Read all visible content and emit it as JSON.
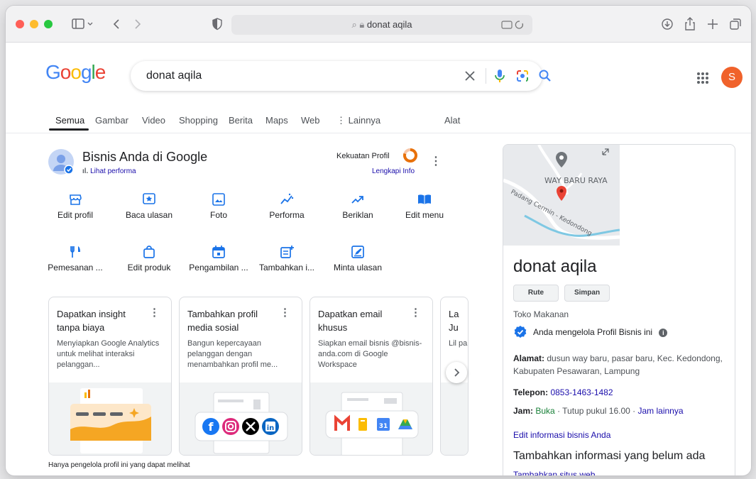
{
  "browser": {
    "address": "donat aqila",
    "reader_label": "Reader"
  },
  "google": {
    "logo": [
      "G",
      "o",
      "o",
      "g",
      "l",
      "e"
    ],
    "query": "donat aqila",
    "avatar_initial": "S",
    "tabs": [
      {
        "label": "Semua"
      },
      {
        "label": "Gambar"
      },
      {
        "label": "Video"
      },
      {
        "label": "Shopping"
      },
      {
        "label": "Berita"
      },
      {
        "label": "Maps"
      },
      {
        "label": "Web"
      },
      {
        "label": "⋮ Lainnya"
      },
      {
        "label": "Alat"
      }
    ]
  },
  "profile": {
    "title": "Bisnis Anda di Google",
    "performance_link": "Lihat performa",
    "strength_label": "Kekuatan Profil",
    "complete_link": "Lengkapi Info",
    "actions": [
      {
        "label": "Edit profil",
        "icon": "storefront-icon"
      },
      {
        "label": "Baca ulasan",
        "icon": "review-star-icon"
      },
      {
        "label": "Foto",
        "icon": "photo-icon"
      },
      {
        "label": "Performa",
        "icon": "performance-icon"
      },
      {
        "label": "Beriklan",
        "icon": "trend-icon"
      },
      {
        "label": "Edit menu",
        "icon": "menu-book-icon"
      },
      {
        "label": "Pemesanan ...",
        "icon": "restaurant-icon"
      },
      {
        "label": "Edit produk",
        "icon": "shopping-bag-icon"
      },
      {
        "label": "Pengambilan ...",
        "icon": "calendar-icon"
      },
      {
        "label": "Tambahkan i...",
        "icon": "add-post-icon"
      },
      {
        "label": "Minta ulasan",
        "icon": "request-review-icon"
      }
    ],
    "cards": [
      {
        "title": "Dapatkan insight tanpa biaya",
        "desc": "Menyiapkan Google Analytics untuk melihat interaksi pelanggan..."
      },
      {
        "title": "Tambahkan profil media sosial",
        "desc": "Bangun kepercayaan pelanggan dengan menambahkan profil me..."
      },
      {
        "title": "Dapatkan email khusus",
        "desc": "Siapkan email bisnis @bisnis-anda.com di Google Workspace"
      },
      {
        "title": "La Ju",
        "desc": "Lil pa"
      }
    ],
    "footer_note": "Hanya pengelola profil ini yang dapat melihat"
  },
  "panel": {
    "map_label_area": "WAY BARU RAYA",
    "map_label_road": "Padang Cermin - Kedondong",
    "name": "donat aqila",
    "route_btn": "Rute",
    "save_btn": "Simpan",
    "category": "Toko Makanan",
    "manage_text": "Anda mengelola Profil Bisnis ini",
    "address_label": "Alamat:",
    "address_value": "dusun way baru, pasar baru, Kec. Kedondong, Kabupaten Pesawaran, Lampung",
    "phone_label": "Telepon:",
    "phone_value": "0853-1463-1482",
    "hours_label": "Jam:",
    "hours_open": "Buka",
    "hours_close": "· Tutup pukul 16.00 ·",
    "hours_more": "Jam lainnya",
    "edit_info": "Edit informasi bisnis Anda",
    "add_info_heading": "Tambahkan informasi yang belum ada",
    "add_website": "Tambahkan situs web"
  },
  "colors": {
    "google_blue": "#4285f4",
    "google_red": "#ea4335",
    "google_yellow": "#fbbc05",
    "google_green": "#34a853",
    "link": "#1a0dab"
  }
}
